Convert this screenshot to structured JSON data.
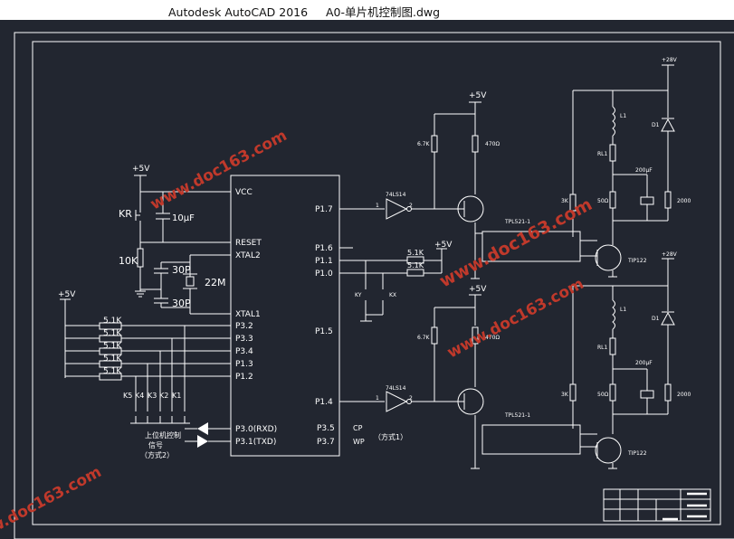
{
  "window": {
    "title": "Autodesk AutoCAD 2016     A0-单片机控制图.dwg"
  },
  "colors": {
    "background": "#222630",
    "line": "#ffffff",
    "watermark": "#c0392b"
  },
  "watermark": {
    "text": "www.doc163.com"
  },
  "mcu": {
    "left_pins": [
      "VCC",
      "RESET",
      "XTAL2",
      "XTAL1",
      "P3.2",
      "P3.3",
      "P3.4",
      "P1.3",
      "P1.2",
      "P3.0(RXD)",
      "P3.1(TXD)"
    ],
    "right_pins": [
      "P1.7",
      "P1.6",
      "P1.1",
      "P1.0",
      "P1.5",
      "P1.4",
      "P3.5",
      "P3.7"
    ],
    "right_pin_signals": [
      "CP",
      "WP"
    ],
    "mode_label": "（方式1）"
  },
  "supply": {
    "vcc": "+5V",
    "v28": "+28V"
  },
  "components": {
    "kr": "KR",
    "cap_reset": "10μF",
    "r_reset": "10K",
    "xtal_cap_1": "30P",
    "xtal_cap_2": "30P",
    "crystal": "22M",
    "pullup": "5.1K",
    "keys": [
      "K5",
      "K4",
      "K3",
      "K2",
      "K1"
    ],
    "host_label_1": "上位机控制",
    "host_label_2": "信号",
    "host_label_3": "（方式2）",
    "ky": "KY",
    "kx": "KX",
    "buffer": "74LS14",
    "r_67k": "6.7K",
    "r_470": "470Ω",
    "opto": "TPL521-1",
    "transistor": "TIP122",
    "inductor": "L1",
    "rl1": "RL1",
    "cap_200": "200μF",
    "r_500": "50Ω",
    "r_2000": "2000",
    "r_3k": "3K",
    "diode": "D1",
    "pin_1": "1",
    "pin_2": "2"
  }
}
